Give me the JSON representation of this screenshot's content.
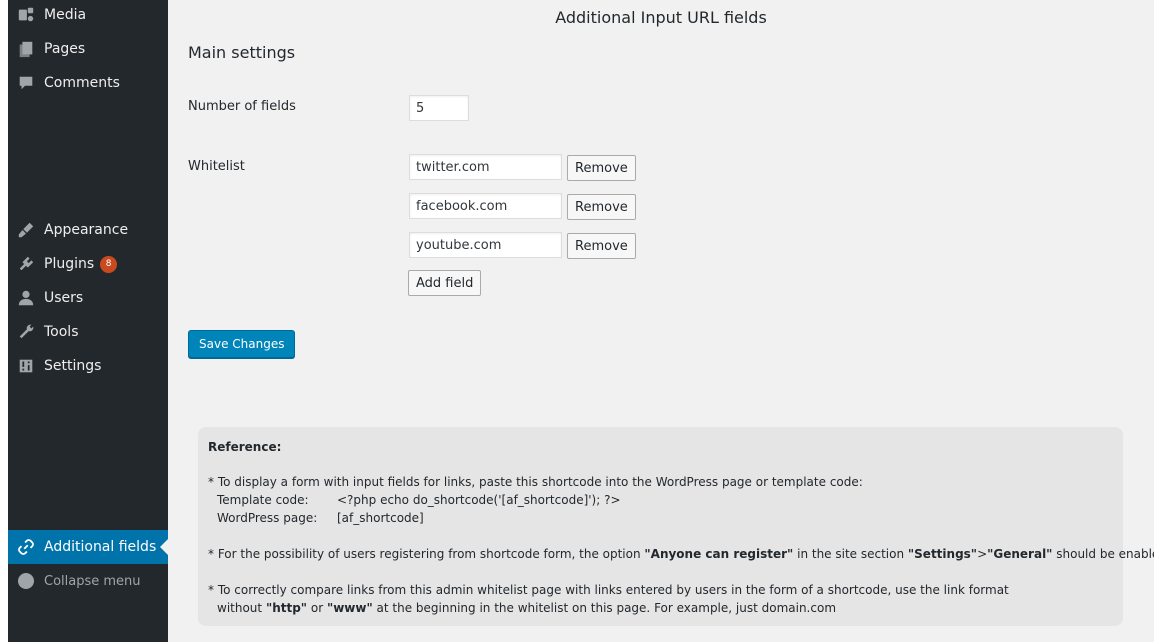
{
  "sidebar": {
    "items": [
      {
        "label": "Media",
        "icon": "media-icon"
      },
      {
        "label": "Pages",
        "icon": "pages-icon"
      },
      {
        "label": "Comments",
        "icon": "comments-icon"
      },
      {
        "label": "Appearance",
        "icon": "appearance-icon"
      },
      {
        "label": "Plugins",
        "icon": "plugins-icon",
        "badge": "8"
      },
      {
        "label": "Users",
        "icon": "users-icon"
      },
      {
        "label": "Tools",
        "icon": "tools-icon"
      },
      {
        "label": "Settings",
        "icon": "settings-icon"
      }
    ],
    "active_item": {
      "label": "Additional fields",
      "icon": "link-icon"
    },
    "collapse_label": "Collapse menu"
  },
  "page": {
    "title": "Additional Input URL fields",
    "section_title": "Main settings",
    "number_of_fields_label": "Number of fields",
    "number_of_fields_value": "5",
    "whitelist_label": "Whitelist",
    "whitelist": [
      "twitter.com",
      "facebook.com",
      "youtube.com"
    ],
    "remove_label": "Remove",
    "add_field_label": "Add field",
    "save_label": "Save Changes"
  },
  "reference": {
    "heading": "Reference:",
    "line1": "* To display a form with input fields for links, paste this shortcode into the WordPress page or template code:",
    "template_code_label": "Template code:",
    "template_code_value": "<?php echo do_shortcode('[af_shortcode]'); ?>",
    "wordpress_page_label": "WordPress page:",
    "wordpress_page_value": "[af_shortcode]",
    "line2_a": "* For the possibility of users registering from shortcode form, the option ",
    "line2_b": "\"Anyone can register\"",
    "line2_c": " in the site section ",
    "line2_d": "\"Settings\"",
    "line2_e": ">",
    "line2_f": "\"General\"",
    "line2_g": " should be enabled.",
    "line3": "* To correctly compare links from this admin whitelist page with links entered by users in the form of a shortcode, use the link format",
    "line4_a": "without ",
    "line4_b": "\"http\"",
    "line4_c": " or ",
    "line4_d": "\"www\"",
    "line4_e": " at the beginning in the whitelist on this page. For example, just domain.com"
  },
  "colors": {
    "sidebar_bg": "#23282d",
    "active_bg": "#0073aa",
    "primary_button": "#0085ba",
    "badge": "#ca4a1f",
    "page_bg": "#f1f1f1"
  }
}
